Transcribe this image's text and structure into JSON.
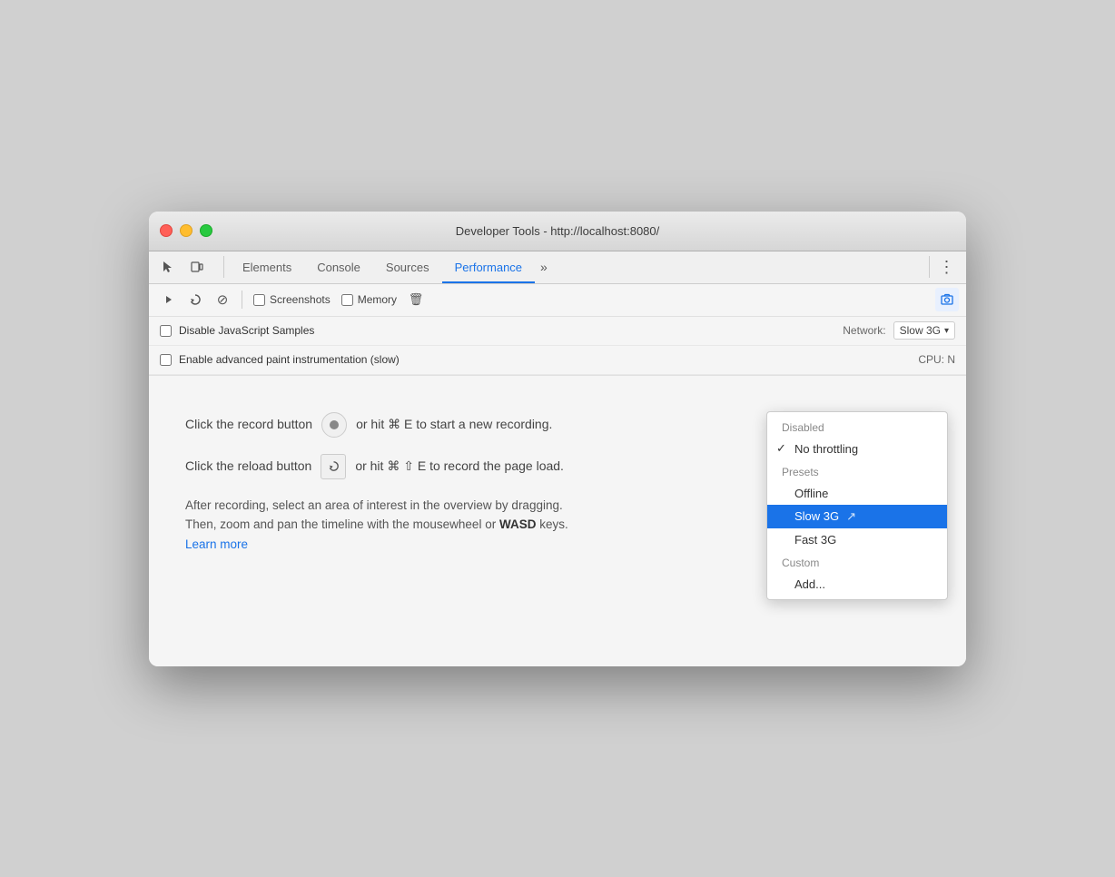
{
  "window": {
    "title": "Developer Tools - http://localhost:8080/"
  },
  "tabs": {
    "items": [
      {
        "id": "elements",
        "label": "Elements"
      },
      {
        "id": "console",
        "label": "Console"
      },
      {
        "id": "sources",
        "label": "Sources"
      },
      {
        "id": "performance",
        "label": "Performance"
      }
    ],
    "more_label": "»",
    "active": "performance"
  },
  "toolbar": {
    "record_label": "●",
    "reload_label": "↺",
    "clear_label": "⊘",
    "screenshots_label": "Screenshots",
    "memory_label": "Memory",
    "delete_label": "🗑",
    "network_label": "Network:",
    "cpu_label": "CPU:"
  },
  "settings_rows": [
    {
      "checkbox": false,
      "label": "Disable JavaScript Samples",
      "right_label": "Network:",
      "network_value": "Slow 3G ▾"
    },
    {
      "checkbox": false,
      "label": "Enable advanced paint instrumentation (slow)",
      "right_label": "CPU: N",
      "cpu_value": ""
    }
  ],
  "main": {
    "record_hint": "Click the record button",
    "record_icon_label": "●",
    "record_shortcut": "or hit ⌘ E to start a new recording.",
    "reload_hint": "Click the reload button",
    "reload_icon_label": "↺",
    "reload_shortcut": "or hit ⌘ ⇧ E to record the page load.",
    "info_text": "After recording, select an area of interest in the overview by dragging.\nThen, zoom and pan the timeline with the mousewheel or",
    "info_bold": "WASD",
    "info_text2": "keys.",
    "learn_more": "Learn more"
  },
  "dropdown": {
    "items": [
      {
        "id": "disabled",
        "label": "Disabled",
        "type": "section-header"
      },
      {
        "id": "no-throttling",
        "label": "No throttling",
        "checked": true
      },
      {
        "id": "presets",
        "label": "Presets",
        "type": "section-header"
      },
      {
        "id": "offline",
        "label": "Offline"
      },
      {
        "id": "slow-3g",
        "label": "Slow 3G",
        "highlighted": true
      },
      {
        "id": "fast-3g",
        "label": "Fast 3G"
      },
      {
        "id": "custom",
        "label": "Custom",
        "type": "section-header"
      },
      {
        "id": "add",
        "label": "Add..."
      }
    ]
  }
}
